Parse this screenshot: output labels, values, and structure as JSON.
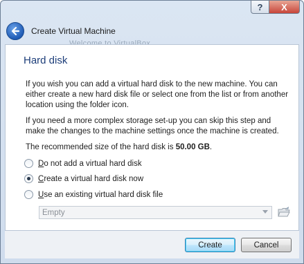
{
  "window": {
    "title": "Create Virtual Machine",
    "help_label": "?",
    "close_label": "X",
    "ghost_heading": "Welcome to VirtualBox"
  },
  "page": {
    "title": "Hard disk",
    "paragraph1": "If you wish you can add a virtual hard disk to the new machine. You can either create a new hard disk file or select one from the list or from another location using the folder icon.",
    "paragraph2": "If you need a more complex storage set-up you can skip this step and make the changes to the machine settings once the machine is created.",
    "recommend_prefix": "The recommended size of the hard disk is ",
    "recommend_value": "50.00 GB",
    "recommend_suffix": "."
  },
  "options": [
    {
      "label_first": "D",
      "label_rest": "o not add a virtual hard disk",
      "checked": false
    },
    {
      "label_first": "C",
      "label_rest": "reate a virtual hard disk now",
      "checked": true
    },
    {
      "label_first": "U",
      "label_rest": "se an existing virtual hard disk file",
      "checked": false
    }
  ],
  "existing_disk": {
    "value": "Empty"
  },
  "buttons": {
    "create": "Create",
    "cancel": "Cancel"
  },
  "icons": {
    "back": "back-arrow-icon",
    "folder": "folder-open-icon",
    "dropdown": "chevron-down-icon"
  },
  "colors": {
    "title_blue": "#1c3d79",
    "frame": "#dbe6f3",
    "close_red": "#c8463b"
  }
}
